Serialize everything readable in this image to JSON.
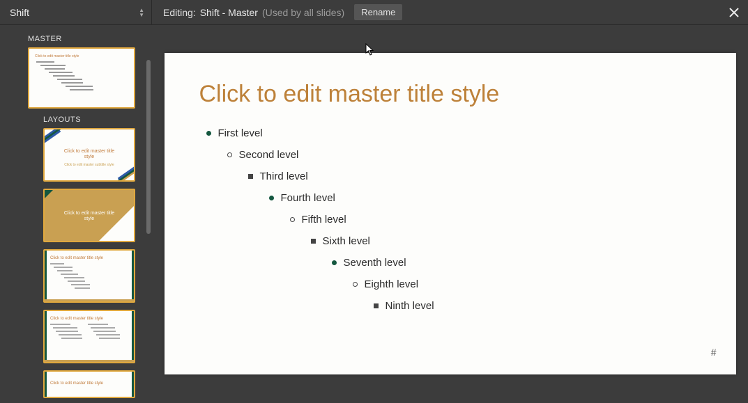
{
  "topbar": {
    "theme_name": "Shift",
    "editing_prefix": "Editing:",
    "editing_name": "Shift - Master",
    "editing_usage": "(Used by all slides)",
    "rename_label": "Rename"
  },
  "sidebar": {
    "master_heading": "MASTER",
    "layouts_heading": "LAYOUTS",
    "master_thumb_title": "Click to edit master title style",
    "layout_thumbs": [
      {
        "title": "Click to edit master title\nstyle",
        "subtitle": "Click to edit master subtitle style"
      },
      {
        "title": "Click to edit master title\nstyle"
      },
      {
        "title": "Click to edit master title style"
      },
      {
        "title": "Click to edit master title style"
      },
      {
        "title": "Click to edit master title style"
      }
    ]
  },
  "slide": {
    "title": "Click to edit master title style",
    "levels": [
      "First level",
      "Second level",
      "Third level",
      "Fourth level",
      "Fifth level",
      "Sixth level",
      "Seventh level",
      "Eighth level",
      "Ninth level"
    ],
    "page_number": "#"
  },
  "colors": {
    "accent": "#bd8139",
    "gold": "#c9a052",
    "dark_green": "#14573f",
    "thumb_border": "#e0a83e"
  }
}
